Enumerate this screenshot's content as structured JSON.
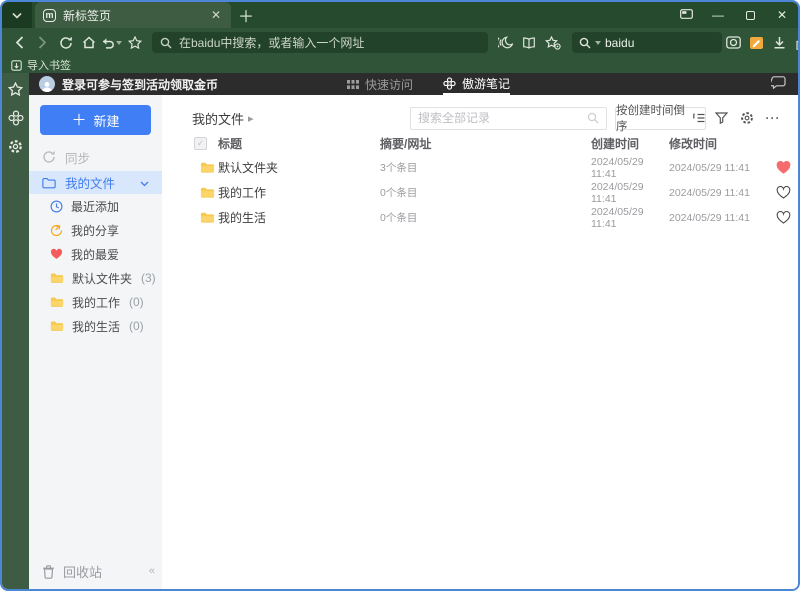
{
  "colors": {
    "theme_green": "#2f5437",
    "accent_blue": "#3f7ef4",
    "heart_red": "#f66c6c",
    "folder_yellow": "#f8c94e",
    "window_border": "#4c86d6"
  },
  "browser": {
    "tab_title": "新标签页",
    "url_placeholder": "在baidu中搜索，或者输入一个网址",
    "search_value": "baidu",
    "import_bookmarks_label": "导入书签"
  },
  "app": {
    "login_banner": "登录可参与签到活动领取金币",
    "tabs": {
      "quick_access": "快速访问",
      "notes": "傲游笔记"
    }
  },
  "sidebar": {
    "new_button": "新建",
    "sync_label": "同步",
    "my_files_label": "我的文件",
    "items": [
      {
        "label": "最近添加",
        "count": ""
      },
      {
        "label": "我的分享",
        "count": ""
      },
      {
        "label": "我的最爱",
        "count": ""
      },
      {
        "label": "默认文件夹",
        "count": "(3)"
      },
      {
        "label": "我的工作",
        "count": "(0)"
      },
      {
        "label": "我的生活",
        "count": "(0)"
      }
    ],
    "recycle_bin_label": "回收站"
  },
  "content": {
    "breadcrumb": "我的文件",
    "search_placeholder": "搜索全部记录",
    "sort_button": "按创建时间倒序",
    "columns": [
      "标题",
      "摘要/网址",
      "创建时间",
      "修改时间"
    ],
    "rows": [
      {
        "title": "默认文件夹",
        "summary": "3个条目",
        "created": "2024/05/29 11:41",
        "modified": "2024/05/29 11:41",
        "favorite": true
      },
      {
        "title": "我的工作",
        "summary": "0个条目",
        "created": "2024/05/29 11:41",
        "modified": "2024/05/29 11:41",
        "favorite": false
      },
      {
        "title": "我的生活",
        "summary": "0个条目",
        "created": "2024/05/29 11:41",
        "modified": "2024/05/29 11:41",
        "favorite": false
      }
    ]
  }
}
